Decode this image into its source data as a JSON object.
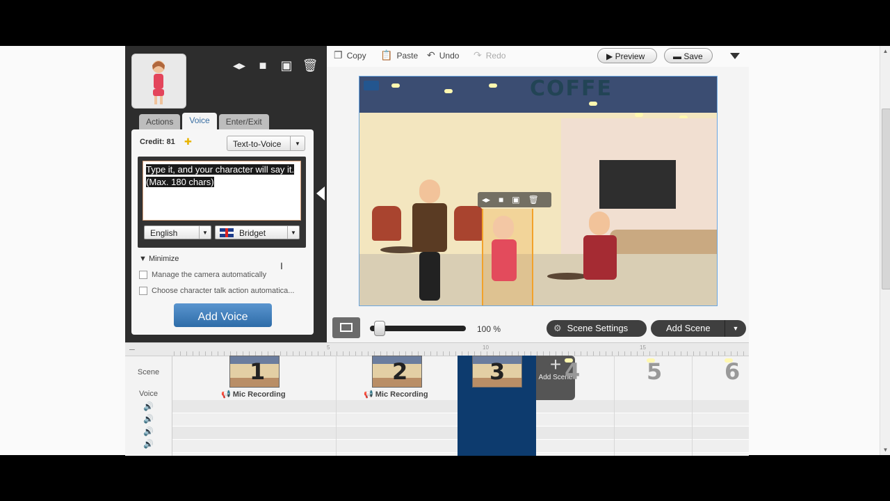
{
  "left_panel": {
    "tabs": [
      "Actions",
      "Voice",
      "Enter/Exit"
    ],
    "credit_label": "Credit: 81",
    "tts_select": "Text-to-Voice",
    "text_input_value": "Type it, and your character will say it.  (Max.  180 chars)",
    "language": "English",
    "voice": "Bridget",
    "minimize_label": "Minimize",
    "checkbox_camera": "Manage the camera automatically",
    "checkbox_talk": "Choose character talk action automatica...",
    "add_voice_label": "Add Voice"
  },
  "toolbar": {
    "copy": "Copy",
    "paste": "Paste",
    "undo": "Undo",
    "redo": "Redo",
    "preview": "Preview",
    "save": "Save"
  },
  "stage": {
    "sign_text": "COFFE"
  },
  "controls": {
    "zoom_level": "100 %",
    "zoom_fraction": 0.05,
    "scene_settings": "Scene Settings",
    "add_scene": "Add Scene"
  },
  "timeline": {
    "ruler_labels": [
      "5",
      "10",
      "15"
    ],
    "row_labels": {
      "scene": "Scene",
      "voice": "Voice"
    },
    "scenes": [
      "1",
      "2",
      "3",
      "4",
      "5",
      "6"
    ],
    "mic_label": "Mic Recording",
    "add_scene_label": "Add Scene"
  },
  "colors": {
    "accent": "#2e6ca8",
    "selected_scene": "#0d3b6e"
  }
}
